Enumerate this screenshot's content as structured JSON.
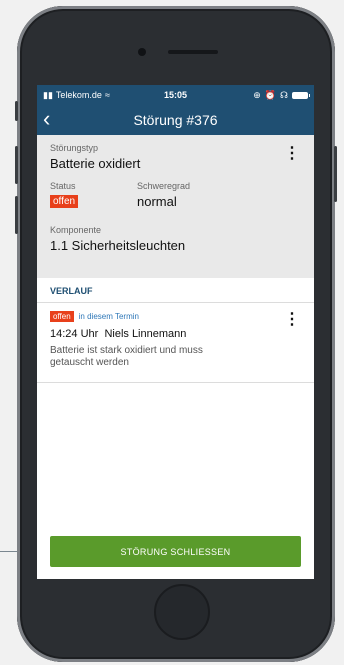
{
  "status_bar": {
    "carrier": "Telekom.de",
    "time": "15:05"
  },
  "nav": {
    "title": "Störung  #376"
  },
  "detail": {
    "type_label": "Störungstyp",
    "type_value": "Batterie oxidiert",
    "status_label": "Status",
    "status_value": "offen",
    "severity_label": "Schweregrad",
    "severity_value": "normal",
    "component_label": "Komponente",
    "component_value": "1.1 Sicherheitsleuchten"
  },
  "history": {
    "heading": "VERLAUF",
    "entries": [
      {
        "status": "offen",
        "context": "in diesem Termin",
        "time": "14:24 Uhr",
        "author": "Niels Linnemann",
        "text": "Batterie ist stark oxidiert und muss getauscht werden"
      }
    ]
  },
  "actions": {
    "close_label": "STÖRUNG SCHLIESSEN"
  },
  "colors": {
    "header": "#1f4f72",
    "badge": "#e8401b",
    "primary": "#5a9b2b"
  }
}
